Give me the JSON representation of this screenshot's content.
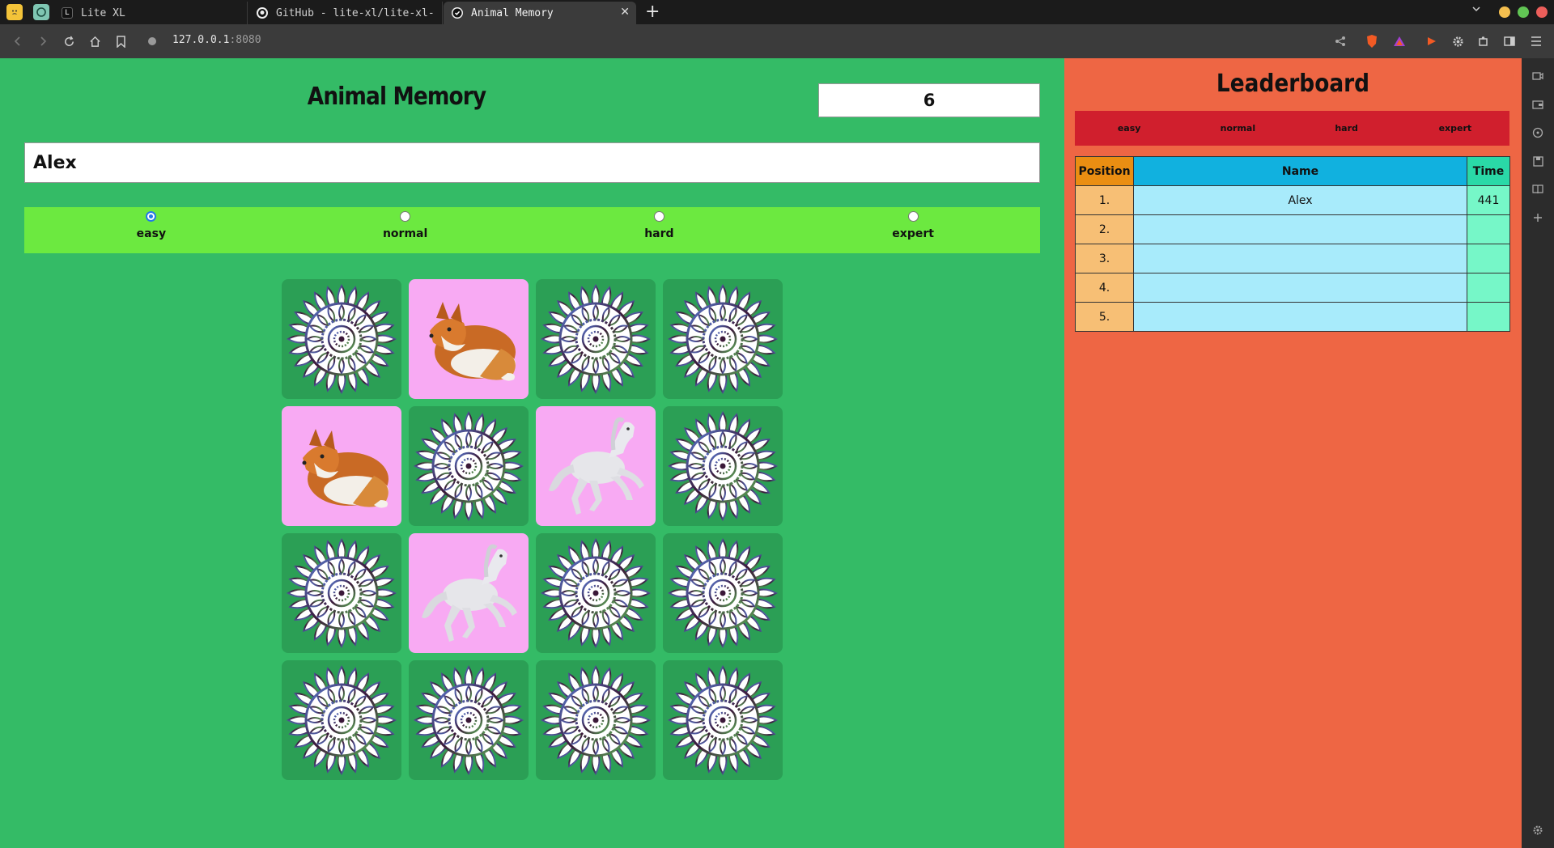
{
  "browser": {
    "pinned_tabs": [
      {
        "icon": "emoji-face-icon"
      },
      {
        "icon": "chatgpt-icon"
      }
    ],
    "tabs": [
      {
        "title": "Lite XL",
        "icon": "lite-xl-icon",
        "active": false
      },
      {
        "title": "GitHub - lite-xl/lite-xl-",
        "icon": "github-icon",
        "active": false
      },
      {
        "title": "Animal Memory",
        "icon": "page-icon",
        "active": true
      }
    ],
    "new_tab_symbol": "+",
    "close_symbol": "✕",
    "url_host": "127.0.0.1",
    "url_port": ":8080",
    "window_colors": {
      "minimize": "#f5bf4f",
      "maximize": "#61c554",
      "close": "#ed5f5b"
    }
  },
  "game": {
    "title": "Animal Memory",
    "timer": "6",
    "player_name": "Alex",
    "difficulties": [
      {
        "label": "easy",
        "checked": true
      },
      {
        "label": "normal",
        "checked": false
      },
      {
        "label": "hard",
        "checked": false
      },
      {
        "label": "expert",
        "checked": false
      }
    ],
    "cards": [
      {
        "state": "hidden",
        "animal": ""
      },
      {
        "state": "revealed",
        "animal": "fox"
      },
      {
        "state": "hidden",
        "animal": ""
      },
      {
        "state": "hidden",
        "animal": ""
      },
      {
        "state": "revealed",
        "animal": "fox"
      },
      {
        "state": "hidden",
        "animal": ""
      },
      {
        "state": "revealed",
        "animal": "horse"
      },
      {
        "state": "hidden",
        "animal": ""
      },
      {
        "state": "hidden",
        "animal": ""
      },
      {
        "state": "revealed",
        "animal": "horse"
      },
      {
        "state": "hidden",
        "animal": ""
      },
      {
        "state": "hidden",
        "animal": ""
      },
      {
        "state": "hidden",
        "animal": ""
      },
      {
        "state": "hidden",
        "animal": ""
      },
      {
        "state": "hidden",
        "animal": ""
      },
      {
        "state": "hidden",
        "animal": ""
      }
    ],
    "colors": {
      "background": "#34bb66",
      "card_back": "#2b9f55",
      "card_face": "#f8aaf3",
      "difficulty_bar": "#6ce940"
    }
  },
  "leaderboard": {
    "title": "Leaderboard",
    "tabs": [
      "easy",
      "normal",
      "hard",
      "expert"
    ],
    "columns": {
      "position": "Position",
      "name": "Name",
      "time": "Time"
    },
    "rows": [
      {
        "position": "1.",
        "name": "Alex",
        "time": "441"
      },
      {
        "position": "2.",
        "name": "",
        "time": ""
      },
      {
        "position": "3.",
        "name": "",
        "time": ""
      },
      {
        "position": "4.",
        "name": "",
        "time": ""
      },
      {
        "position": "5.",
        "name": "",
        "time": ""
      }
    ],
    "colors": {
      "background": "#ee6644",
      "tabs_bar": "#d01f2d"
    }
  }
}
